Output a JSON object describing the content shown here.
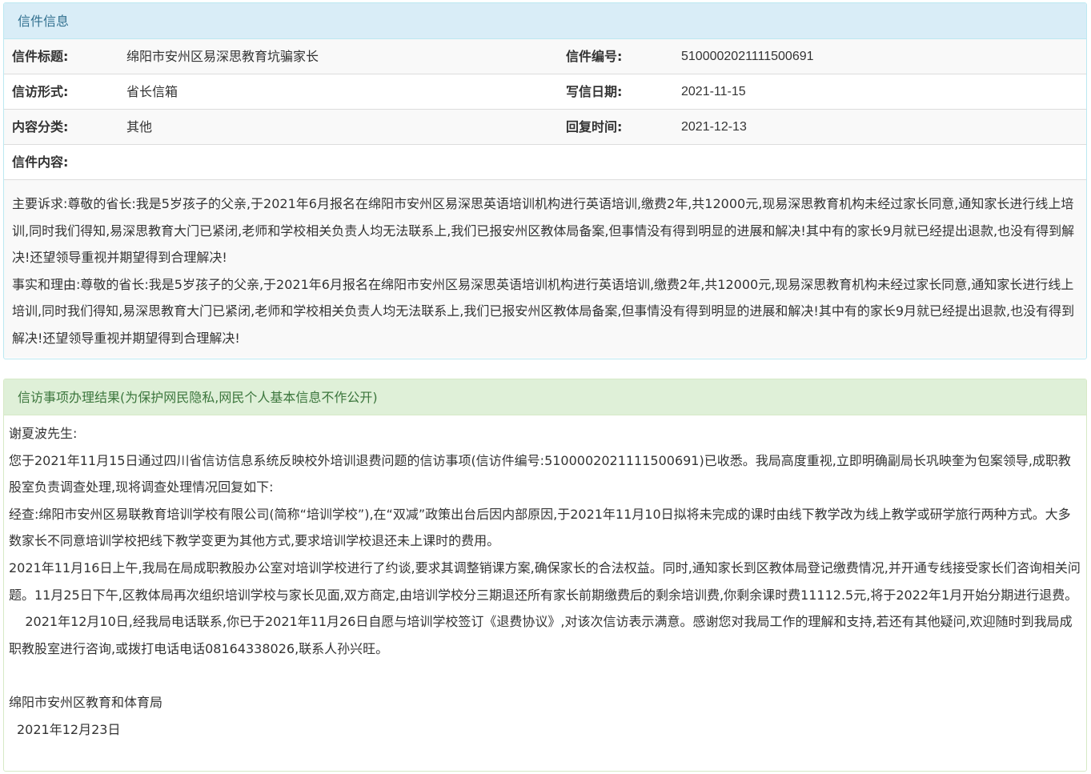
{
  "letter": {
    "heading": "信件信息",
    "rows": [
      {
        "label1": "信件标题:",
        "value1": "绵阳市安州区易深思教育坑骗家长",
        "label2": "信件编号:",
        "value2": "5100002021111500691"
      },
      {
        "label1": "信访形式:",
        "value1": "省长信箱",
        "label2": "写信日期:",
        "value2": "2021-11-15"
      },
      {
        "label1": "内容分类:",
        "value1": "其他",
        "label2": "回复时间:",
        "value2": "2021-12-13"
      }
    ],
    "content_label": "信件内容:",
    "content": [
      "主要诉求:尊敬的省长:我是5岁孩子的父亲,于2021年6月报名在绵阳市安州区易深思英语培训机构进行英语培训,缴费2年,共12000元,现易深思教育机构未经过家长同意,通知家长进行线上培训,同时我们得知,易深思教育大门已紧闭,老师和学校相关负责人均无法联系上,我们已报安州区教体局备案,但事情没有得到明显的进展和解决!其中有的家长9月就已经提出退款,也没有得到解决!还望领导重视并期望得到合理解决!",
      "事实和理由:尊敬的省长:我是5岁孩子的父亲,于2021年6月报名在绵阳市安州区易深思英语培训机构进行英语培训,缴费2年,共12000元,现易深思教育机构未经过家长同意,通知家长进行线上培训,同时我们得知,易深思教育大门已紧闭,老师和学校相关负责人均无法联系上,我们已报安州区教体局备案,但事情没有得到明显的进展和解决!其中有的家长9月就已经提出退款,也没有得到解决!还望领导重视并期望得到合理解决!"
    ]
  },
  "result": {
    "heading": "信访事项办理结果(为保护网民隐私,网民个人基本信息不作公开)",
    "greeting": "谢夏波先生:",
    "paragraphs": [
      "您于2021年11月15日通过四川省信访信息系统反映校外培训退费问题的信访事项(信访件编号:5100002021111500691)已收悉。我局高度重视,立即明确副局长巩映奎为包案领导,成职教股室负责调查处理,现将调查处理情况回复如下:",
      "经查:绵阳市安州区易联教育培训学校有限公司(简称“培训学校”),在“双减”政策出台后因内部原因,于2021年11月10日拟将未完成的课时由线下教学改为线上教学或研学旅行两种方式。大多数家长不同意培训学校把线下教学变更为其他方式,要求培训学校退还未上课时的费用。",
      "2021年11月16日上午,我局在局成职教股办公室对培训学校进行了约谈,要求其调整销课方案,确保家长的合法权益。同时,通知家长到区教体局登记缴费情况,并开通专线接受家长们咨询相关问题。11月25日下午,区教体局再次组织培训学校与家长见面,双方商定,由培训学校分三期退还所有家长前期缴费后的剩余培训费,你剩余课时费11112.5元,将于2022年1月开始分期进行退费。",
      "    2021年12月10日,经我局电话联系,你已于2021年11月26日自愿与培训学校签订《退费协议》,对该次信访表示满意。感谢您对我局工作的理解和支持,若还有其他疑问,欢迎随时到我局成职教股室进行咨询,或拨打电话电话08164338026,联系人孙兴旺。"
    ],
    "signature": "绵阳市安州区教育和体育局",
    "date": "2021年12月23日"
  }
}
